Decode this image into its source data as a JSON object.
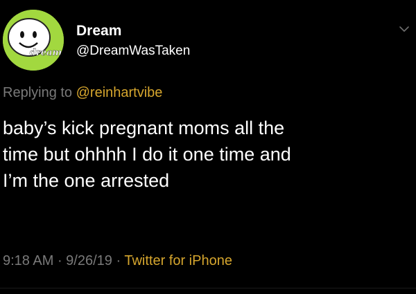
{
  "user": {
    "display_name": "Dream",
    "handle": "@DreamWasTaken",
    "avatar_label": "dream",
    "avatar_color": "#a2d83f"
  },
  "reply": {
    "prefix": "Replying to ",
    "mention": "@reinhartvibe"
  },
  "tweet": {
    "text": "baby’s kick pregnant moms all the\ntime but ohhhh I do it one time and\nI’m the one arrested"
  },
  "meta": {
    "time": "9:18 AM",
    "separator": " · ",
    "date": "9/26/19",
    "separator2": " · ",
    "source": "Twitter for iPhone"
  },
  "colors": {
    "background": "#000000",
    "text": "#ffffff",
    "secondary": "#7a7a7a",
    "accent": "#d6a62e"
  },
  "icons": {
    "menu": "chevron-down-icon"
  }
}
